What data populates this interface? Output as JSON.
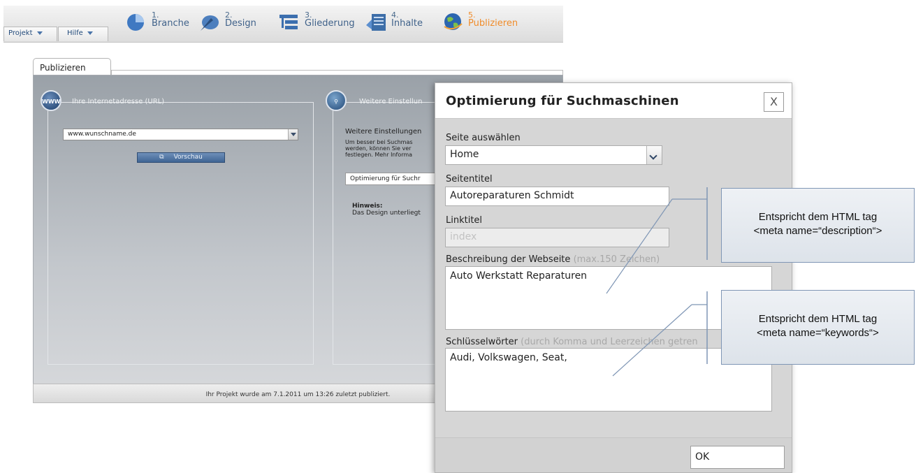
{
  "menubar": {
    "projekt_label": "Projekt",
    "hilfe_label": "Hilfe"
  },
  "steps": [
    {
      "num": "1.",
      "label": "Branche",
      "icon": "pie-chart-icon"
    },
    {
      "num": "2.",
      "label": "Design",
      "icon": "brush-icon"
    },
    {
      "num": "3.",
      "label": "Gliederung",
      "icon": "tree-structure-icon"
    },
    {
      "num": "4.",
      "label": "Inhalte",
      "icon": "content-blocks-icon"
    },
    {
      "num": "5.",
      "label": "Publizieren",
      "icon": "globe-icon",
      "active": true
    }
  ],
  "tab": {
    "label": "Publizieren"
  },
  "url_panel": {
    "icon_text": "WWW",
    "title": "Ihre Internetadresse (URL)",
    "url_value": "www.wunschname.de",
    "preview_label": "Vorschau"
  },
  "settings_panel": {
    "title": "Weitere Einstellun",
    "heading": "Weitere Einstellungen",
    "desc_lines": [
      "Um besser bei Suchmas",
      "werden, können Sie ver",
      "festlegen. Mehr Informa"
    ],
    "seo_button": "Optimierung für Suchr",
    "hint_label": "Hinweis:",
    "hint_text": "Das Design unterliegt"
  },
  "status": {
    "text": "Ihr Projekt wurde am 7.1.2011 um 13:26 zuletzt publiziert."
  },
  "dialog": {
    "title": "Optimierung für Suchmaschinen",
    "close_label": "X",
    "page_select_label": "Seite auswählen",
    "page_select_value": "Home",
    "page_title_label": "Seitentitel",
    "page_title_value": "Autoreparaturen Schmidt",
    "link_title_label": "Linktitel",
    "link_title_value": "index",
    "description_label": "Beschreibung der Webseite",
    "description_hint": "(max.150 Zeichen)",
    "description_value": "Auto Werkstatt Reparaturen",
    "keywords_label": "Schlüsselwörter",
    "keywords_hint": "(durch Komma und Leerzeichen getren",
    "keywords_value": "Audi, Volkswagen, Seat,",
    "ok_label": "OK"
  },
  "callouts": [
    {
      "line1": "Entspricht dem HTML tag",
      "line2": "<meta name=“description“>"
    },
    {
      "line1": "Entspricht dem HTML tag",
      "line2": "<meta name=“keywords“>"
    }
  ],
  "colors": {
    "active_step": "#f08c2a",
    "step_text": "#40628a",
    "dialog_bg": "#d6d6d6",
    "callout_border": "#7f96b5"
  }
}
